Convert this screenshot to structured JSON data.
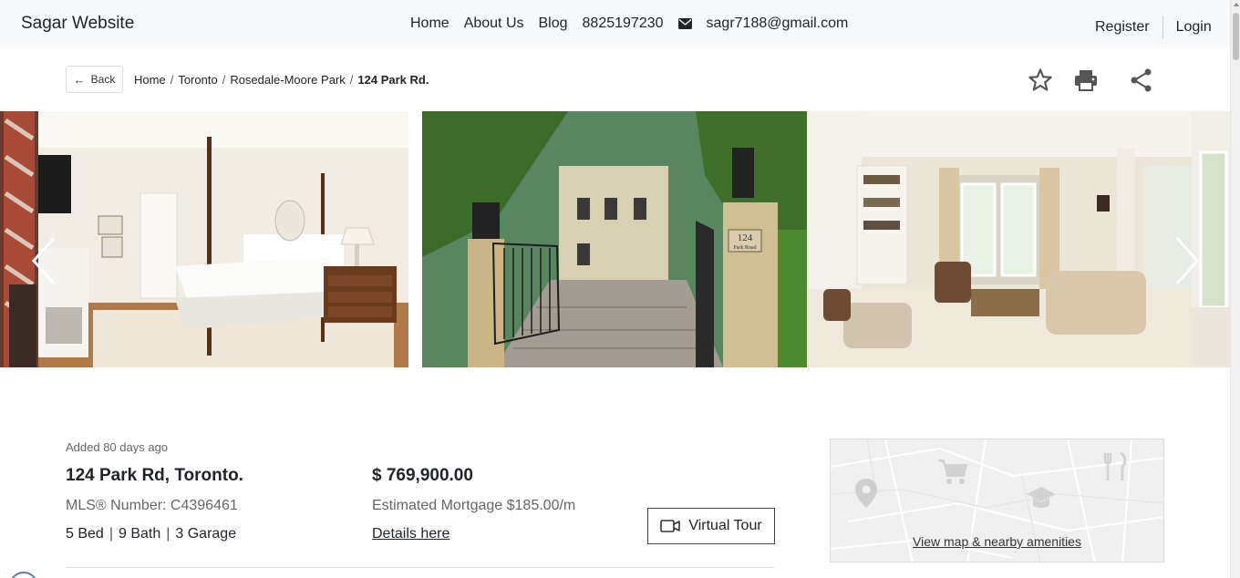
{
  "nav": {
    "brand": "Sagar Website",
    "links": [
      "Home",
      "About Us",
      "Blog"
    ],
    "phone": "8825197230",
    "email": "sagr7188@gmail.com",
    "register": "Register",
    "login": "Login"
  },
  "breadcrumb": {
    "back_label": "Back",
    "items": [
      "Home",
      "Toronto",
      "Rosedale-Moore Park"
    ],
    "current": "124 Park Rd."
  },
  "gallery": {
    "gate_sign_number": "124",
    "gate_sign_street": "Park Road"
  },
  "listing": {
    "added": "Added 80 days ago",
    "address": "124 Park Rd, Toronto.",
    "mls": "MLS® Number: C4396461",
    "beds": "5 Bed",
    "baths": "9 Bath",
    "garage": "3 Garage",
    "price": "$ 769,900.00",
    "mortgage": "Estimated Mortgage $185.00/m",
    "details_link": "Details here",
    "virtual_tour": "Virtual Tour"
  },
  "map": {
    "link_label": "View map & nearby amenities"
  },
  "colors": {
    "navbar_bg": "#f8f9fa",
    "text": "#212529",
    "muted": "#666666"
  }
}
